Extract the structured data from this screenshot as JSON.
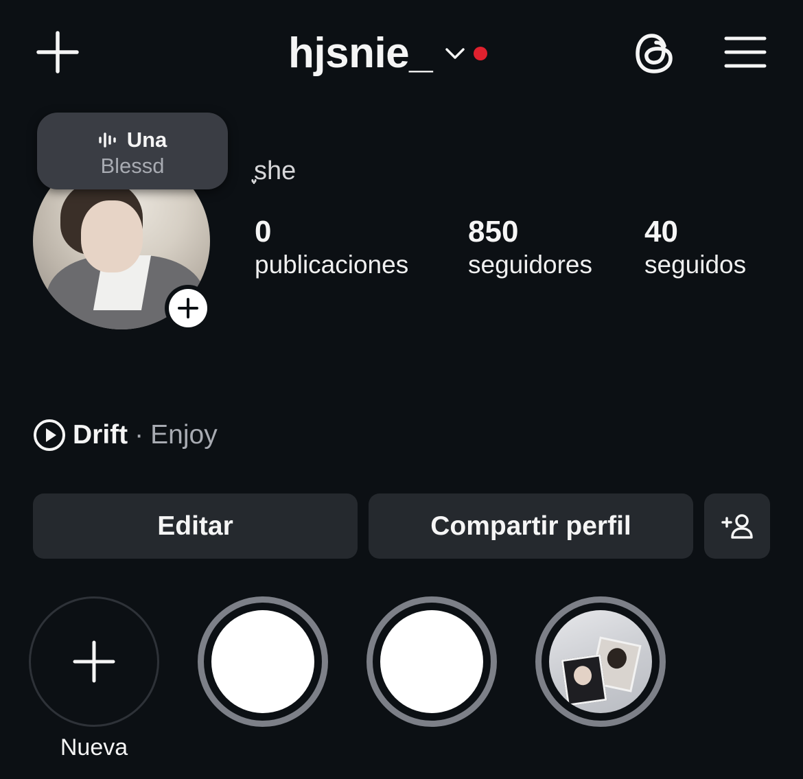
{
  "header": {
    "username": "hjsnie_",
    "notification_dot_color": "#e0212e",
    "icons": [
      "plus-icon",
      "chevron-down-icon",
      "threads-icon",
      "menu-icon"
    ]
  },
  "note": {
    "title": "Una",
    "subtitle": "Blessd",
    "icon": "audio-wave-icon"
  },
  "profile": {
    "bio_name": "ֶָ֢she"
  },
  "stats": {
    "posts": {
      "value": "0",
      "label": "publicaciones"
    },
    "followers": {
      "value": "850",
      "label": "seguidores"
    },
    "following": {
      "value": "40",
      "label": "seguidos"
    }
  },
  "music": {
    "icon": "play-circle-icon",
    "title": "Drift",
    "separator": "·",
    "artist": "Enjoy"
  },
  "actions": {
    "edit_label": "Editar",
    "share_label": "Compartir perfil",
    "add_user_icon": "add-user-icon"
  },
  "highlights": {
    "new_label": "Nueva",
    "ring_color": "#7d8088"
  }
}
